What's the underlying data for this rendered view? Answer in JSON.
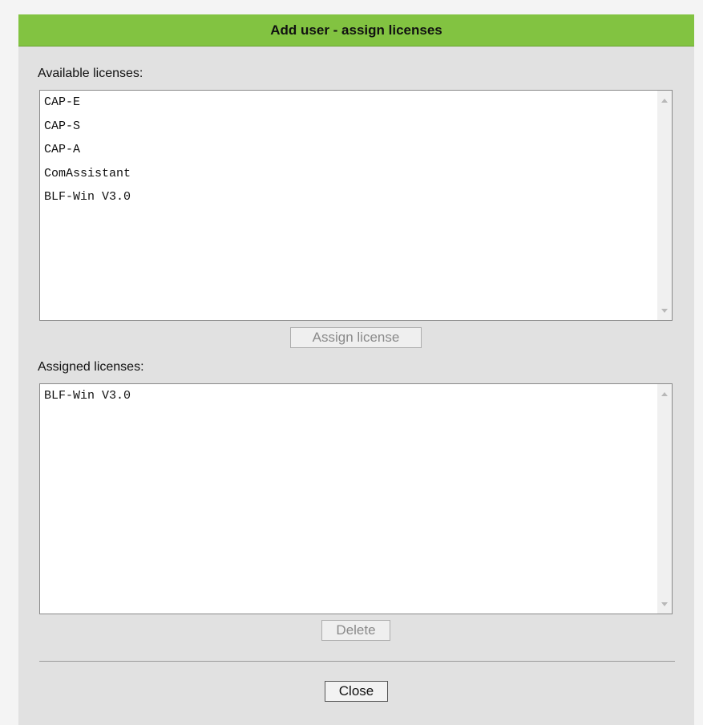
{
  "dialog": {
    "title": "Add user - assign licenses",
    "title_bar_color": "#82c341",
    "background_color": "#e1e1e1"
  },
  "available": {
    "label": "Available licenses:",
    "items": [
      "CAP-E",
      "CAP-S",
      "CAP-A",
      "ComAssistant",
      "BLF-Win V3.0"
    ],
    "assign_button": "Assign license"
  },
  "assigned": {
    "label": "Assigned licenses:",
    "items": [
      "BLF-Win V3.0"
    ],
    "delete_button": "Delete"
  },
  "footer": {
    "close_button": "Close"
  },
  "icons": {
    "scroll_up": "scroll-up-arrow-icon",
    "scroll_down": "scroll-down-arrow-icon"
  }
}
